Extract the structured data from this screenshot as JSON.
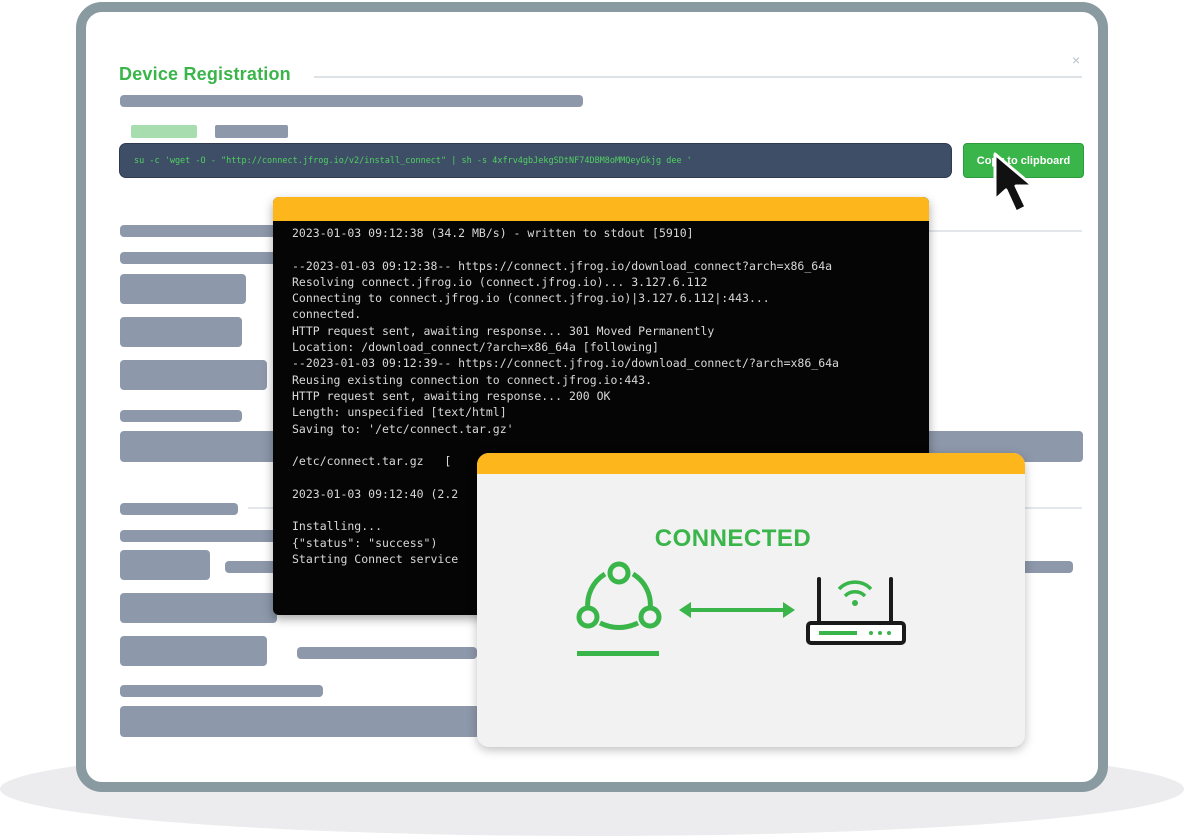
{
  "dialog": {
    "title": "Device Registration",
    "close_label": "×",
    "command": "su -c 'wget -O - \"http://connect.jfrog.io/v2/install_connect\" | sh -s 4xfrv4gbJekgSDtNF74DBM8oMMQeyGkjg dee '",
    "copy_button_label": "Copy to clipboard"
  },
  "terminal": {
    "lines": [
      "2023-01-03 09:12:38 (34.2 MB/s) - written to stdout [5910]",
      "",
      "--2023-01-03 09:12:38-- https://connect.jfrog.io/download_connect?arch=x86_64a",
      "Resolving connect.jfrog.io (connect.jfrog.io)... 3.127.6.112",
      "Connecting to connect.jfrog.io (connect.jfrog.io)|3.127.6.112|:443...",
      "connected.",
      "HTTP request sent, awaiting response... 301 Moved Permanently",
      "Location: /download_connect/?arch=x86_64a [following]",
      "--2023-01-03 09:12:39-- https://connect.jfrog.io/download_connect/?arch=x86_64a",
      "Reusing existing connection to connect.jfrog.io:443.",
      "HTTP request sent, awaiting response... 200 OK",
      "Length: unspecified [text/html]",
      "Saving to: '/etc/connect.tar.gz'",
      "",
      "/etc/connect.tar.gz   [",
      "",
      "2023-01-03 09:12:40 (2.2",
      "",
      "Installing...",
      "{\"status\": \"success\")",
      "Starting Connect service"
    ]
  },
  "status_card": {
    "title": "CONNECTED",
    "left_icon": "connect-hub-icon",
    "middle_icon": "double-arrow-icon",
    "right_icon": "router-wifi-icon"
  },
  "colors": {
    "accent_green": "#3ab54a",
    "accent_yellow": "#fdb71c",
    "frame": "#8a9aa1",
    "placeholder": "#8d98aa",
    "terminal_bg": "#050505",
    "command_bg": "#3f4e67"
  }
}
